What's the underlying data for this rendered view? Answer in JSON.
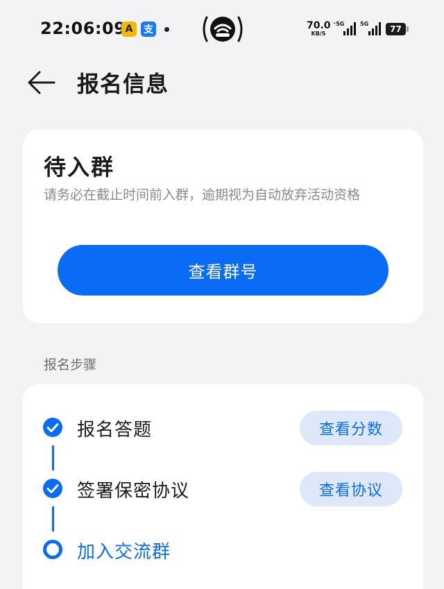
{
  "status_bar": {
    "time": "22:06:09",
    "app_icon_1": "A",
    "app_icon_2": "支",
    "net_speed_value": "70.0",
    "net_speed_unit": "KB/S",
    "signal_1_label": "⁺5G",
    "signal_2_label": "5G",
    "battery": "77"
  },
  "header": {
    "title": "报名信息"
  },
  "status_card": {
    "title": "待入群",
    "description": "请务必在截止时间前入群，逾期视为自动放弃活动资格",
    "button_label": "查看群号"
  },
  "steps_section": {
    "label": "报名步骤",
    "steps": [
      {
        "label": "报名答题",
        "state": "done",
        "action_label": "查看分数"
      },
      {
        "label": "签署保密协议",
        "state": "done",
        "action_label": "查看协议"
      },
      {
        "label": "加入交流群",
        "state": "current"
      }
    ]
  },
  "colors": {
    "accent": "#0a6cf5",
    "pill_bg": "#dde8f8",
    "page_bg": "#f1f3f5",
    "card_bg": "#ffffff",
    "muted_text": "#8a8a8a"
  },
  "icons": {
    "back": "arrow-left-icon",
    "hotspot": "hotspot-icon",
    "step_done": "check-circle-icon",
    "step_current": "ring-circle-icon"
  }
}
